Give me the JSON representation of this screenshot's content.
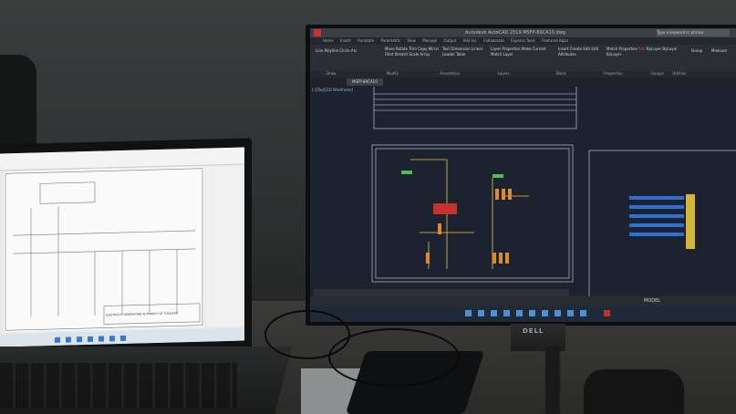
{
  "scene": {
    "description_label": "photo-of-desk-with-laptop-and-monitor"
  },
  "monitor": {
    "brand": "DELL",
    "app_title": "Autodesk AutoCAD 2019  MSFP-80CA10.dwg",
    "search_placeholder": "Type a keyword or phrase",
    "ribbon_tabs": [
      "Home",
      "Insert",
      "Annotate",
      "Parametric",
      "View",
      "Manage",
      "Output",
      "Add-ins",
      "Collaborate",
      "Express Tools",
      "Featured Apps"
    ],
    "ribbon_groups": [
      "Draw",
      "Modify",
      "Annotation",
      "Layers",
      "Block",
      "Properties",
      "Groups",
      "Utilities"
    ],
    "draw_tools": [
      "Line",
      "Polyline",
      "Circle",
      "Arc"
    ],
    "modify_tools": [
      "Move",
      "Rotate",
      "Trim",
      "Copy",
      "Mirror",
      "Fillet",
      "Stretch",
      "Scale",
      "Array"
    ],
    "annotation_tools": [
      "Text",
      "Dimension",
      "Linear",
      "Leader",
      "Table"
    ],
    "layer_tools": [
      "Layer Properties",
      "Make Current",
      "Match Layer"
    ],
    "block_tools": [
      "Insert",
      "Create",
      "Edit",
      "Edit Attributes"
    ],
    "properties_tools": [
      "Match Properties",
      "ByLayer",
      "ByLayer",
      "ByLayer"
    ],
    "properties_color": "Red",
    "group_tools": [
      "Group"
    ],
    "utility_tools": [
      "Measure"
    ],
    "doc_tab": "MSFP-80CA10",
    "viewport_label": "[-][Top][2D Wireframe]",
    "model_label": "MODEL",
    "accent": "#c8302b",
    "canvas_bg": "#1c2230"
  },
  "laptop": {
    "app": "PDF viewer",
    "page_title": "ELECTRICITY GENERATING AUTHORITY OF THAILAND",
    "taskbar_present": true
  }
}
